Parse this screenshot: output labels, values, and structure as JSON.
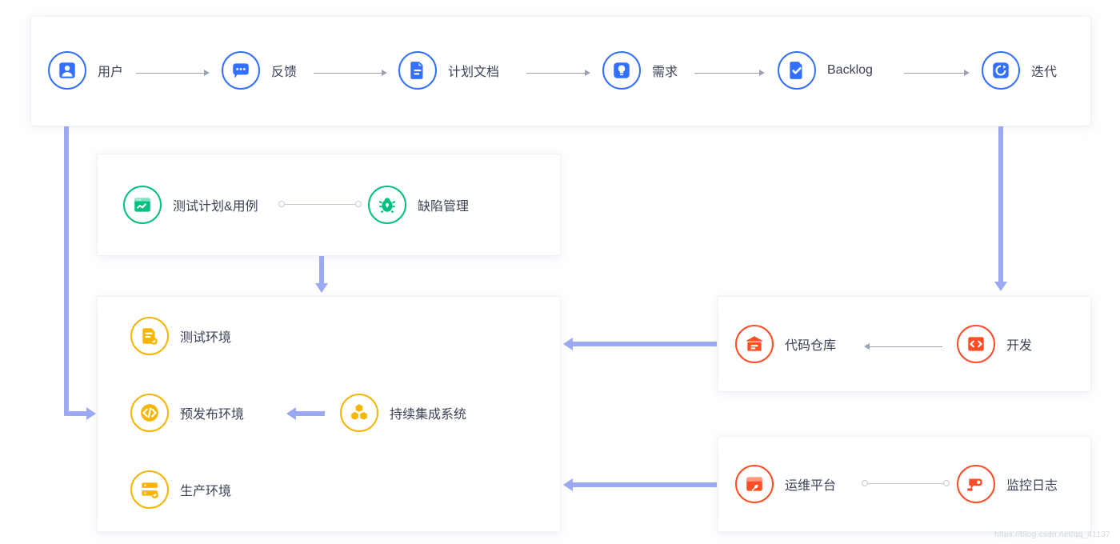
{
  "top": {
    "user": "用户",
    "feedback": "反馈",
    "plan": "计划文档",
    "req": "需求",
    "backlog": "Backlog",
    "iter": "迭代"
  },
  "qa": {
    "testplan": "测试计划&用例",
    "defect": "缺陷管理"
  },
  "env": {
    "test": "测试环境",
    "pre": "预发布环境",
    "ci": "持续集成系统",
    "prod": "生产环境"
  },
  "dev": {
    "repo": "代码仓库",
    "dev": "开发"
  },
  "ops": {
    "platform": "运维平台",
    "monitor": "监控日志"
  },
  "watermark": "https://blog.csdn.net/qq_41137"
}
